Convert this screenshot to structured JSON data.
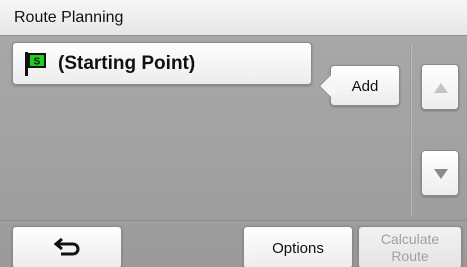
{
  "title": "Route Planning",
  "route_points": [
    {
      "label": "(Starting Point)",
      "flag_letter": "S"
    }
  ],
  "buttons": {
    "add": "Add",
    "options": "Options",
    "calculate_line1": "Calculate",
    "calculate_line2": "Route"
  },
  "icons": {
    "start_flag": "start-flag-icon",
    "scroll_up": "arrow-up-icon",
    "scroll_down": "arrow-down-icon",
    "back": "back-arrow-icon"
  },
  "colors": {
    "flag_green": "#1fcf1f",
    "disabled_text": "#a0a0a0"
  },
  "state": {
    "scroll_up_enabled": false,
    "scroll_down_enabled": true,
    "calculate_enabled": false
  }
}
